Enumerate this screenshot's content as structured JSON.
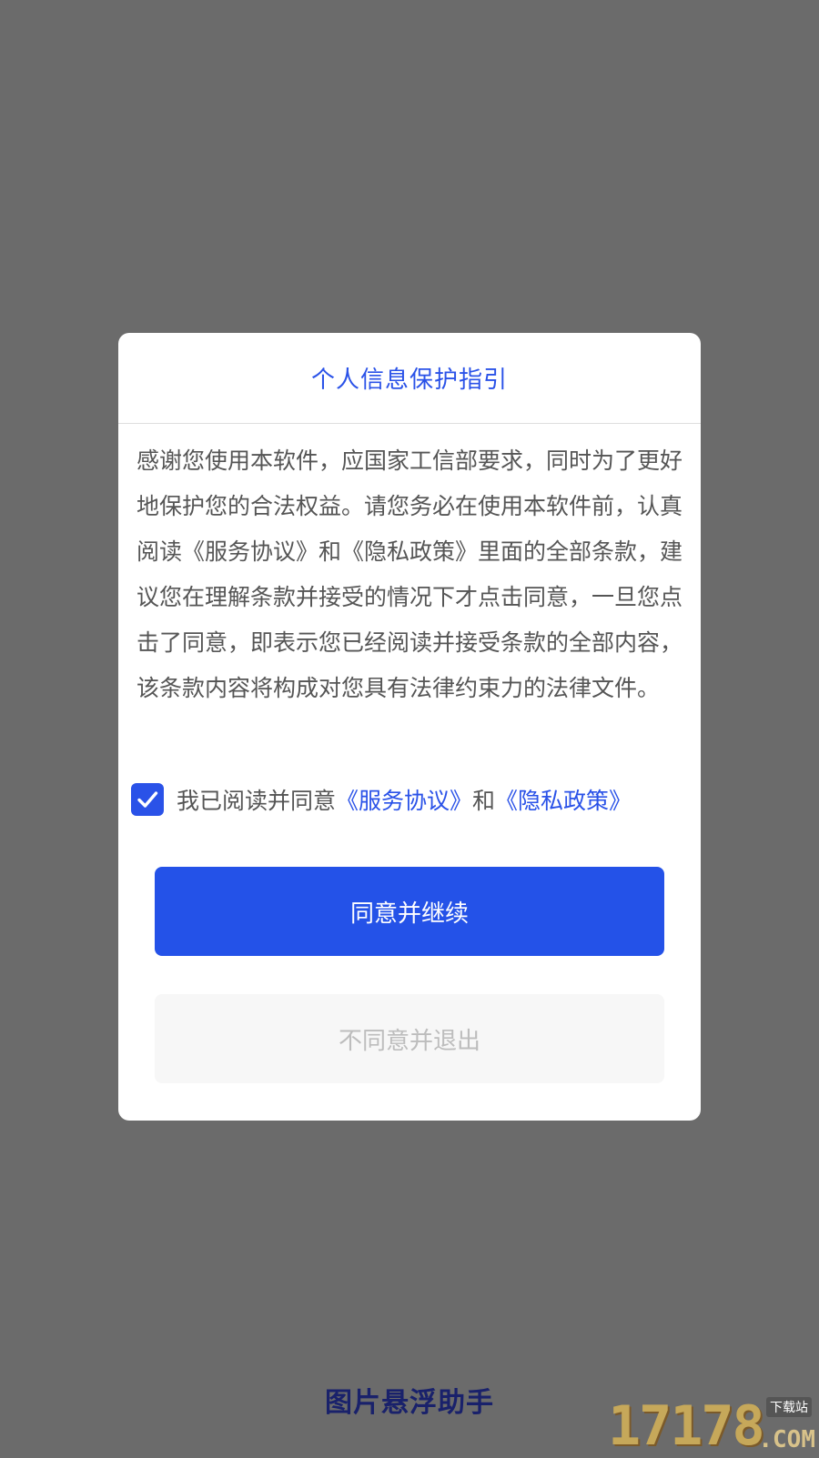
{
  "dialog": {
    "title": "个人信息保护指引",
    "body": "感谢您使用本软件，应国家工信部要求，同时为了更好地保护您的合法权益。请您务必在使用本软件前，认真阅读《服务协议》和《隐私政策》里面的全部条款，建议您在理解条款并接受的情况下才点击同意，一旦您点击了同意，即表示您已经阅读并接受条款的全部内容，该条款内容将构成对您具有法律约束力的法律文件。",
    "agreement": {
      "checked": true,
      "prefix": "我已阅读并同意",
      "terms_link": "《服务协议》",
      "conjunction": "和",
      "privacy_link": "《隐私政策》"
    },
    "agree_button": "同意并继续",
    "disagree_button": "不同意并退出"
  },
  "footer": {
    "label": "图片悬浮助手"
  },
  "watermark": {
    "digits": "17178",
    "domain": ".COM",
    "tag": "下载站"
  },
  "colors": {
    "overlay": "#6b6b6b",
    "accent": "#2a52e8",
    "primary_button": "#2452e8",
    "secondary_button": "#f7f7f7",
    "footer_text": "#19216b"
  }
}
